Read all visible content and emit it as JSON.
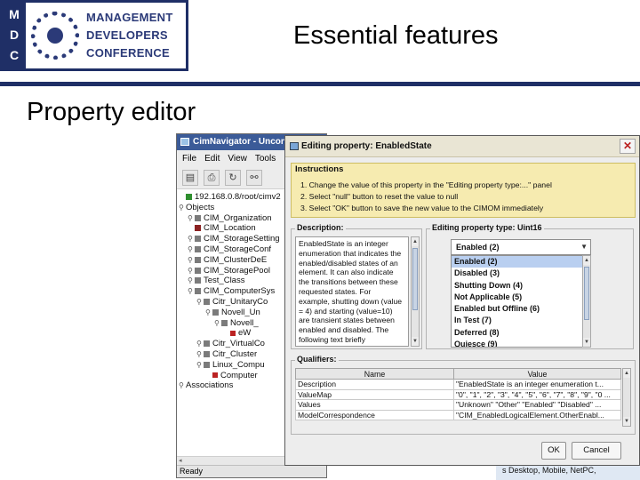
{
  "slide": {
    "logo": {
      "badge_letters": [
        "M",
        "D",
        "C"
      ],
      "lines": [
        "MANAGEMENT",
        "DEVELOPERS",
        "CONFERENCE"
      ]
    },
    "title": "Essential features",
    "subtitle": "Property editor"
  },
  "cimnav": {
    "title": "CimNavigator - Uncont",
    "menu": [
      "File",
      "Edit",
      "View",
      "Tools",
      "H"
    ],
    "toolbar_icons": [
      "save-icon",
      "print-icon",
      "refresh-icon",
      "connect-icon"
    ],
    "tree": [
      {
        "glyph": "",
        "icon": "root",
        "label": "192.168.0.8/root/cimv2"
      },
      {
        "glyph": "⚲",
        "icon": "",
        "label": "Objects"
      },
      {
        "glyph": "⚲",
        "icon": "node",
        "label": "CIM_Organization"
      },
      {
        "glyph": "",
        "icon": "loc",
        "label": "CIM_Location"
      },
      {
        "glyph": "⚲",
        "icon": "node",
        "label": "CIM_StorageSetting"
      },
      {
        "glyph": "⚲",
        "icon": "node",
        "label": "CIM_StorageConf"
      },
      {
        "glyph": "⚲",
        "icon": "node",
        "label": "CIM_ClusterDeE"
      },
      {
        "glyph": "⚲",
        "icon": "node",
        "label": "CIM_StoragePool"
      },
      {
        "glyph": "⚲",
        "icon": "node",
        "label": "Test_Class"
      },
      {
        "glyph": "⚲",
        "icon": "node",
        "label": "CIM_ComputerSys"
      },
      {
        "glyph": "⚲",
        "icon": "node",
        "label": "Citr_UnitaryCo"
      },
      {
        "glyph": "⚲",
        "icon": "node",
        "label": "Novell_Un"
      },
      {
        "glyph": "⚲",
        "icon": "node",
        "label": "Novell_"
      },
      {
        "glyph": "",
        "icon": "flag",
        "label": "eW"
      },
      {
        "glyph": "⚲",
        "icon": "node",
        "label": "Citr_VirtualCo"
      },
      {
        "glyph": "⚲",
        "icon": "node",
        "label": "Citr_Cluster"
      },
      {
        "glyph": "⚲",
        "icon": "node",
        "label": "Linux_Compu"
      },
      {
        "glyph": "",
        "icon": "flag",
        "label": "Computer"
      },
      {
        "glyph": "⚲",
        "icon": "",
        "label": "Associations"
      }
    ],
    "status": "Ready"
  },
  "behind_text": "s Desktop, Mobile, NetPC,",
  "dialog": {
    "title": "Editing property: EnabledState",
    "instructions_heading": "Instructions",
    "instructions": [
      "1. Change the value of this property in the \"Editing property type:...\" panel",
      "2. Select \"null\" button to reset the value to null",
      "3. Select \"OK\" button to save the new value to the CIMOM immediately"
    ],
    "description_heading": "Description:",
    "description_lines": [
      "EnabledState is an integer",
      "enumeration that indicates the",
      "enabled/disabled states of an",
      "element. It can also indicate",
      "the transitions between these",
      "requested states. For",
      "example, shutting down (value",
      "= 4) and starting (value=10)",
      "are transient states between",
      "enabled and disabled. The",
      "following text briefly"
    ],
    "edit_heading": "Editing property type: Uint16",
    "selected_value": "Enabled (2)",
    "options": [
      "Enabled (2)",
      "Disabled (3)",
      "Shutting Down (4)",
      "Not Applicable (5)",
      "Enabled but Offline (6)",
      "In Test (7)",
      "Deferred (8)",
      "Quiesce (9)"
    ],
    "qualifiers_heading": "Qualifiers:",
    "qualifier_columns": [
      "Name",
      "Value"
    ],
    "qualifiers": [
      {
        "name": "Description",
        "value": "\"EnabledState is an integer enumeration t..."
      },
      {
        "name": "ValueMap",
        "value": "\"0\", \"1\", \"2\", \"3\", \"4\", \"5\", \"6\", \"7\", \"8\", \"9\", \"0 ..."
      },
      {
        "name": "Values",
        "value": "\"Unknown\" \"Other\" \"Enabled\" \"Disabled\" ..."
      },
      {
        "name": "ModelCorrespondence",
        "value": "\"CIM_EnabledLogicalElement.OtherEnabl..."
      }
    ],
    "ok_label": "OK",
    "cancel_label": "Cancel"
  }
}
